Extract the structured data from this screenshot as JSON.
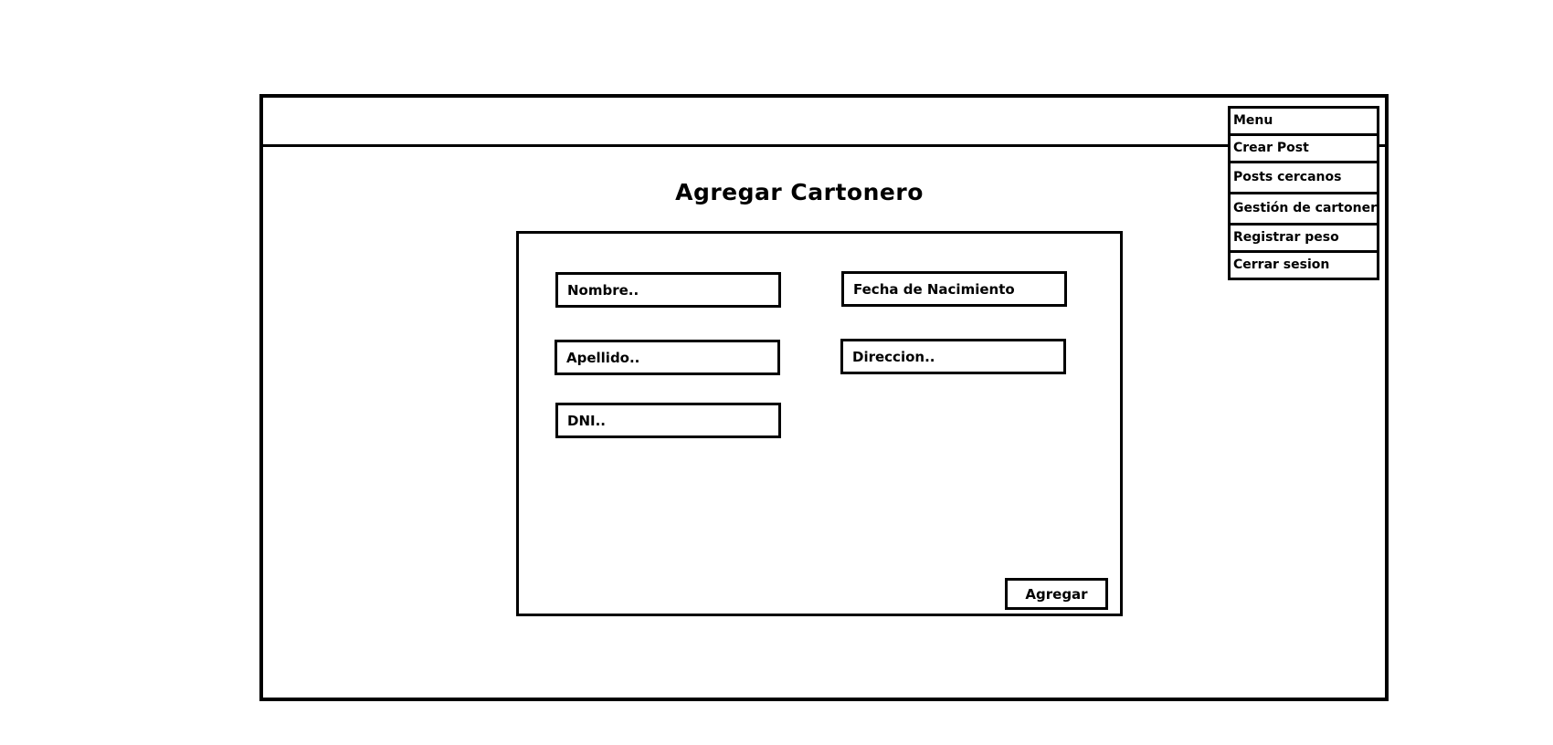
{
  "page": {
    "title": "Agregar Cartonero"
  },
  "menu": {
    "header": "Menu",
    "items": [
      {
        "label": "Crear Post"
      },
      {
        "label": "Posts cercanos"
      },
      {
        "label": "Gestión de cartoneros"
      },
      {
        "label": "Registrar peso"
      },
      {
        "label": "Cerrar sesion"
      }
    ]
  },
  "form": {
    "nombre_placeholder": "Nombre..",
    "apellido_placeholder": "Apellido..",
    "dni_placeholder": "DNI..",
    "fecha_placeholder": "Fecha de Nacimiento",
    "direccion_placeholder": "Direccion..",
    "submit_label": "Agregar"
  }
}
